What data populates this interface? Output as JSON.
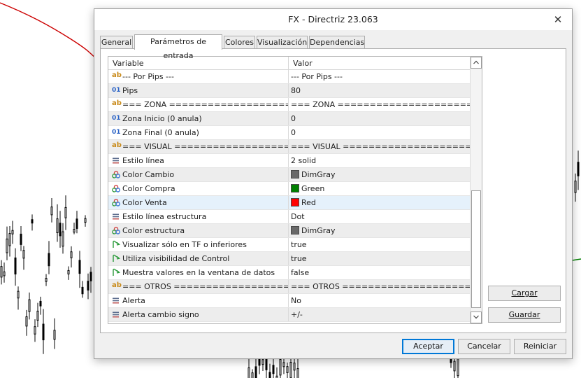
{
  "window": {
    "title": "FX - Directriz 23.063"
  },
  "tabs": [
    {
      "label": "General",
      "active": false
    },
    {
      "label": "Parámetros de entrada",
      "active": true
    },
    {
      "label": "Colores",
      "active": false
    },
    {
      "label": "Visualización",
      "active": false
    },
    {
      "label": "Dependencias",
      "active": false
    }
  ],
  "grid": {
    "columns": {
      "variable": "Variable",
      "value": "Valor"
    },
    "rows": [
      {
        "type": "string",
        "icon": "string-type-icon",
        "variable": "--- Por Pips ---",
        "value": "--- Por Pips ---"
      },
      {
        "type": "int",
        "icon": "integer-type-icon",
        "variable": "Pips",
        "value": "80"
      },
      {
        "type": "string",
        "icon": "string-type-icon",
        "variable": "=== ZONA ========================...",
        "value": "=== ZONA ==========================..."
      },
      {
        "type": "int",
        "icon": "integer-type-icon",
        "variable": "Zona Inicio (0 anula)",
        "value": "0"
      },
      {
        "type": "int",
        "icon": "integer-type-icon",
        "variable": "Zona Final (0 anula)",
        "value": "0"
      },
      {
        "type": "string",
        "icon": "string-type-icon",
        "variable": "=== VISUAL ======================...",
        "value": "=== VISUAL ========================..."
      },
      {
        "type": "enum",
        "icon": "list-type-icon",
        "variable": "Estilo línea",
        "value": "2 solid"
      },
      {
        "type": "color",
        "icon": "color-type-icon",
        "variable": "Color Cambio",
        "value": "DimGray",
        "swatch": "#696969"
      },
      {
        "type": "color",
        "icon": "color-type-icon",
        "variable": "Color Compra",
        "value": "Green",
        "swatch": "#008000"
      },
      {
        "type": "color",
        "icon": "color-type-icon",
        "variable": "Color Venta",
        "value": "Red",
        "swatch": "#ff0000"
      },
      {
        "type": "enum",
        "icon": "list-type-icon",
        "variable": "Estilo línea estructura",
        "value": "Dot"
      },
      {
        "type": "color",
        "icon": "color-type-icon",
        "variable": "Color estructura",
        "value": "DimGray",
        "swatch": "#696969"
      },
      {
        "type": "bool",
        "icon": "boolean-type-icon",
        "variable": "Visualizar sólo en TF o inferiores",
        "value": "true"
      },
      {
        "type": "bool",
        "icon": "boolean-type-icon",
        "variable": "Utiliza visibilidad de Control",
        "value": "true"
      },
      {
        "type": "bool",
        "icon": "boolean-type-icon",
        "variable": "Muestra valores en la ventana de datos",
        "value": "false"
      },
      {
        "type": "string",
        "icon": "string-type-icon",
        "variable": "=== OTROS ======================...",
        "value": "=== OTROS =========================..."
      },
      {
        "type": "enum",
        "icon": "list-type-icon",
        "variable": "Alerta",
        "value": "No"
      },
      {
        "type": "enum",
        "icon": "list-type-icon",
        "variable": "Alerta cambio signo",
        "value": "+/-"
      }
    ]
  },
  "side_buttons": {
    "load": "Cargar",
    "save": "Guardar"
  },
  "footer_buttons": {
    "ok": "Aceptar",
    "cancel": "Cancelar",
    "reset": "Reiniciar"
  },
  "colors": {
    "accent": "#0078d7",
    "selected_row": "#e5f1fb",
    "chart_line_red": "#cc0000",
    "chart_line_green": "#008000"
  }
}
